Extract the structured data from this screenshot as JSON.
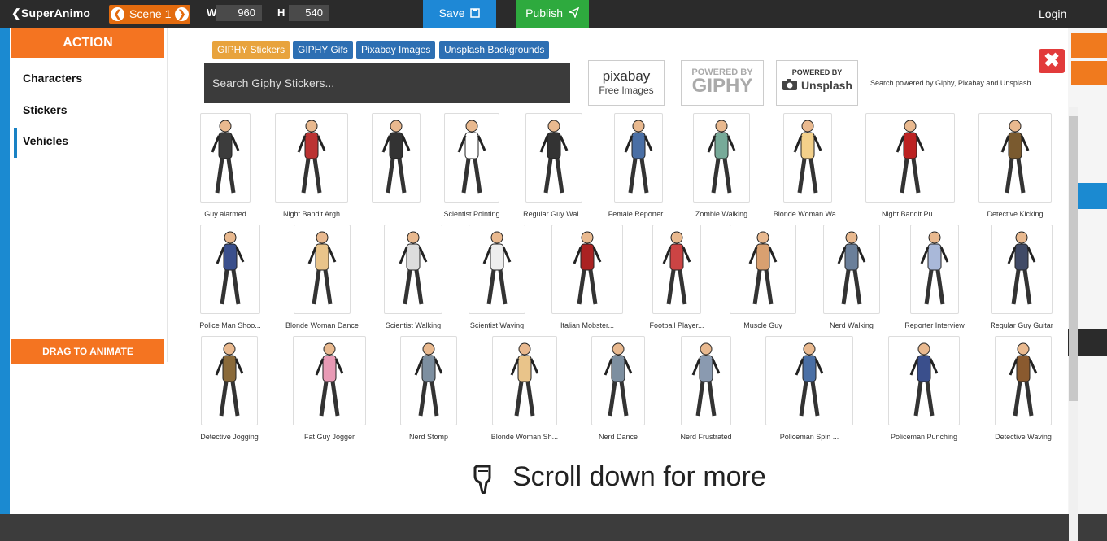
{
  "topbar": {
    "logo": "SuperAnimo",
    "scene_label": "Scene 1",
    "w_label": "W",
    "w_value": "960",
    "h_label": "H",
    "h_value": "540",
    "save_label": "Save",
    "publish_label": "Publish",
    "login_label": "Login"
  },
  "sidebar": {
    "header": "ACTION",
    "items": [
      {
        "label": "Characters"
      },
      {
        "label": "Stickers"
      },
      {
        "label": "Vehicles"
      }
    ],
    "drag_label": "DRAG TO ANIMATE"
  },
  "tabs": [
    {
      "label": "GIPHY Stickers",
      "color": "#e8a33d"
    },
    {
      "label": "GIPHY Gifs",
      "color": "#2d6fb3"
    },
    {
      "label": "Pixabay Images",
      "color": "#2d6fb3"
    },
    {
      "label": "Unsplash Backgrounds",
      "color": "#2d6fb3"
    }
  ],
  "search": {
    "placeholder": "Search Giphy Stickers..."
  },
  "providers": {
    "pixabay_title": "pixabay",
    "pixabay_sub": "Free Images",
    "giphy_top": "POWERED BY",
    "giphy_main": "GIPHY",
    "unsplash_top": "POWERED BY",
    "unsplash_main": "Unsplash",
    "powered_text": "Search powered by Giphy, Pixabay and Unsplash"
  },
  "rows": [
    [
      {
        "label": "Guy alarmed"
      },
      {
        "label": "Night Bandit Argh"
      },
      {
        "label": ""
      },
      {
        "label": "Scientist Pointing"
      },
      {
        "label": "Regular Guy Wal..."
      },
      {
        "label": "Female Reporter..."
      },
      {
        "label": "Zombie Walking"
      },
      {
        "label": "Blonde Woman Wa..."
      },
      {
        "label": "Night Bandit Pu..."
      },
      {
        "label": "Detective Kicking"
      }
    ],
    [
      {
        "label": "Police Man Shoo..."
      },
      {
        "label": "Blonde Woman Dance"
      },
      {
        "label": "Scientist Walking"
      },
      {
        "label": "Scientist Waving"
      },
      {
        "label": "Italian Mobster..."
      },
      {
        "label": "Football Player..."
      },
      {
        "label": "Muscle Guy"
      },
      {
        "label": "Nerd Walking"
      },
      {
        "label": "Reporter Interview"
      },
      {
        "label": "Regular Guy Guitar"
      }
    ],
    [
      {
        "label": "Detective Jogging"
      },
      {
        "label": "Fat Guy Jogger"
      },
      {
        "label": "Nerd Stomp"
      },
      {
        "label": "Blonde Woman Sh..."
      },
      {
        "label": "Nerd Dance"
      },
      {
        "label": "Nerd Frustrated"
      },
      {
        "label": "Policeman Spin ..."
      },
      {
        "label": "Policeman Punching"
      },
      {
        "label": "Detective Waving"
      }
    ]
  ],
  "scroll_more": "Scroll down for more"
}
